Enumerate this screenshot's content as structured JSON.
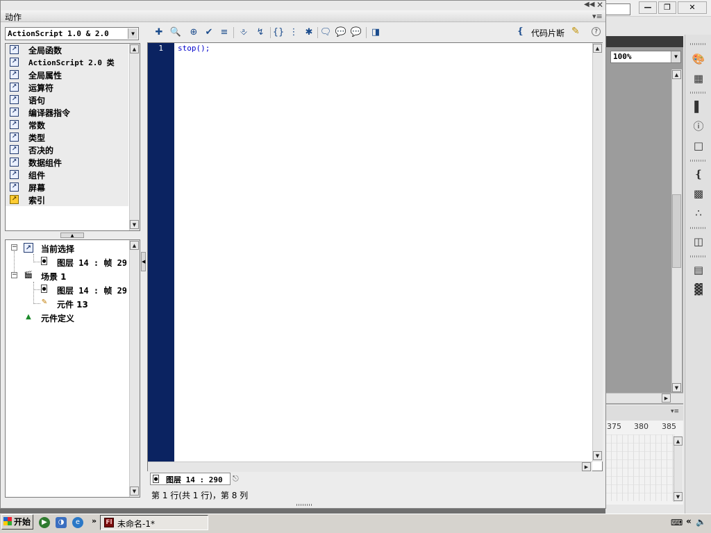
{
  "panel": {
    "title": "动作",
    "version_select": "ActionScript 1.0 & 2.0",
    "toolbox_items": [
      {
        "label": "全局函数",
        "icon": "book-arrow-icon"
      },
      {
        "label": "ActionScript 2.0 类",
        "icon": "book-arrow-icon"
      },
      {
        "label": "全局属性",
        "icon": "book-arrow-icon"
      },
      {
        "label": "运算符",
        "icon": "book-arrow-icon"
      },
      {
        "label": "语句",
        "icon": "book-arrow-icon"
      },
      {
        "label": "编译器指令",
        "icon": "book-arrow-icon"
      },
      {
        "label": "常数",
        "icon": "book-arrow-icon"
      },
      {
        "label": "类型",
        "icon": "book-arrow-icon"
      },
      {
        "label": "否决的",
        "icon": "book-arrow-icon"
      },
      {
        "label": "数据组件",
        "icon": "book-arrow-icon"
      },
      {
        "label": "组件",
        "icon": "book-arrow-icon"
      },
      {
        "label": "屏幕",
        "icon": "book-arrow-icon"
      },
      {
        "label": "索引",
        "icon": "index-icon"
      }
    ],
    "script_navigator": {
      "current_selection": "当前选择",
      "current_frame": "图层 14 : 帧 29",
      "scene": "场景 1",
      "scene_frame": "图层 14 : 帧 29",
      "symbol": "元件 13",
      "symbol_definitions": "元件定义"
    },
    "toolbar": {
      "code_snippets_label": "代码片断"
    },
    "editor": {
      "line_number": "1",
      "code": "stop();"
    },
    "script_tab_label": "图层 14 : 290",
    "status_line": "第 1 行(共 1 行)，第 8 列"
  },
  "background_app": {
    "zoom_value": "100%",
    "timeline_ticks": [
      "375",
      "380",
      "385"
    ]
  },
  "taskbar": {
    "start_label": "开始",
    "task_label": "未命名-1*"
  }
}
